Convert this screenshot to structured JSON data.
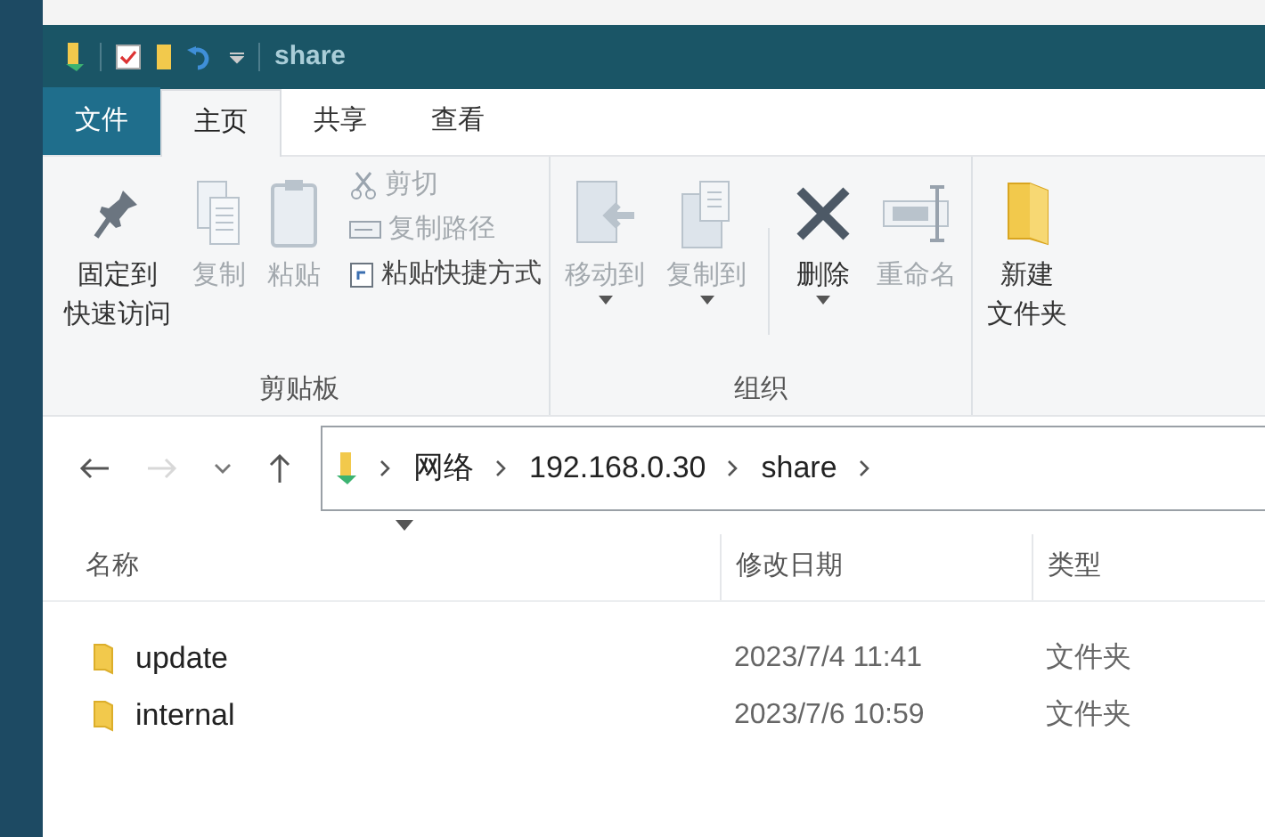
{
  "title_bar": {
    "title": "share"
  },
  "tabs": [
    {
      "label": "文件",
      "kind": "file",
      "selected": false
    },
    {
      "label": "主页",
      "kind": "tab",
      "selected": true
    },
    {
      "label": "共享",
      "kind": "tab",
      "selected": false
    },
    {
      "label": "查看",
      "kind": "tab",
      "selected": false
    }
  ],
  "ribbon": {
    "groups": [
      {
        "label": "剪贴板",
        "items": [
          {
            "kind": "large",
            "lines": [
              "固定到",
              "快速访问"
            ],
            "disabled": false
          },
          {
            "kind": "large",
            "lines": [
              "复制"
            ],
            "disabled": true
          },
          {
            "kind": "large",
            "lines": [
              "粘贴"
            ],
            "disabled": true
          },
          {
            "kind": "small_stack",
            "entries": [
              {
                "label": "剪切",
                "disabled": true
              },
              {
                "label": "复制路径",
                "disabled": true
              },
              {
                "label": "粘贴快捷方式",
                "disabled": false
              }
            ]
          }
        ]
      },
      {
        "label": "组织",
        "items": [
          {
            "kind": "large",
            "lines": [
              "移动到"
            ],
            "disabled": true,
            "dropdown": true
          },
          {
            "kind": "large",
            "lines": [
              "复制到"
            ],
            "disabled": true,
            "dropdown": true
          },
          {
            "kind": "separator"
          },
          {
            "kind": "large",
            "lines": [
              "删除"
            ],
            "disabled": false,
            "dropdown": true
          },
          {
            "kind": "large",
            "lines": [
              "重命名"
            ],
            "disabled": true
          }
        ]
      },
      {
        "items": [
          {
            "kind": "large",
            "lines": [
              "新建",
              "文件夹"
            ],
            "disabled": false
          }
        ]
      }
    ]
  },
  "navigation": {
    "back": {
      "disabled": false
    },
    "forward": {
      "disabled": true
    },
    "up": {
      "disabled": false
    }
  },
  "address_bar": {
    "crumbs": [
      "网络",
      "192.168.0.30",
      "share"
    ]
  },
  "file_list": {
    "columns": [
      "名称",
      "修改日期",
      "类型"
    ],
    "rows": [
      {
        "name": "update",
        "modified": "2023/7/4 11:41",
        "type": "文件夹"
      },
      {
        "name": "internal",
        "modified": "2023/7/6 10:59",
        "type": "文件夹"
      }
    ]
  }
}
